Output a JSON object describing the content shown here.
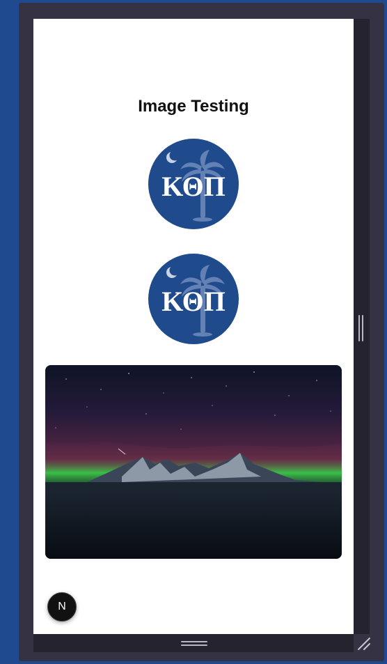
{
  "page": {
    "title": "Image Testing"
  },
  "logos": [
    {
      "text": "ΚΘΠ"
    },
    {
      "text": "ΚΘΠ"
    }
  ],
  "dev_indicator": {
    "label": "N"
  },
  "colors": {
    "background": "#204a8f",
    "frame": "#353243",
    "logo_blue": "#1f4a8c",
    "page_bg": "#ffffff"
  }
}
